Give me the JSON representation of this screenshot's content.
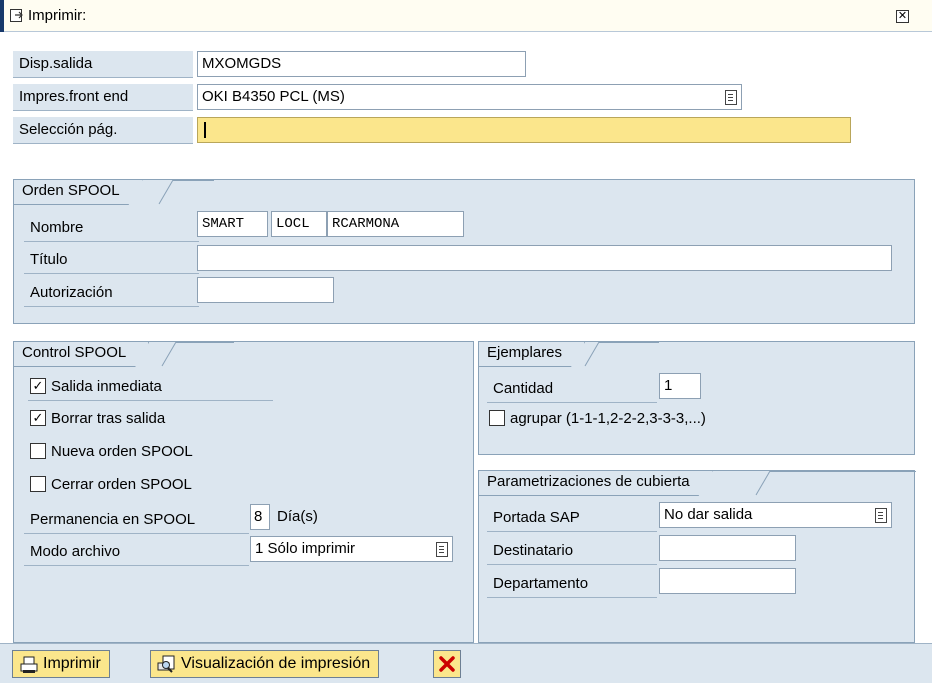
{
  "window": {
    "title": "Imprimir:"
  },
  "main_fields": {
    "disp_salida": {
      "label": "Disp.salida",
      "value": "MXOMGDS"
    },
    "impres_front_end": {
      "label": "Impres.front end",
      "value": "OKI B4350 PCL (MS)"
    },
    "seleccion_pag": {
      "label": "Selección pág.",
      "value": ""
    }
  },
  "orden_spool": {
    "title": "Orden SPOOL",
    "nombre": {
      "label": "Nombre",
      "part1": "SMART",
      "part2": "LOCL",
      "part3": "RCARMONA"
    },
    "titulo": {
      "label": "Título",
      "value": ""
    },
    "autorizacion": {
      "label": "Autorización",
      "value": ""
    }
  },
  "control_spool": {
    "title": "Control SPOOL",
    "salida_inmediata": {
      "label": "Salida inmediata",
      "checked": true
    },
    "borrar_tras_salida": {
      "label": "Borrar tras salida",
      "checked": true
    },
    "nueva_orden": {
      "label": "Nueva orden SPOOL",
      "checked": false
    },
    "cerrar_orden": {
      "label": "Cerrar orden SPOOL",
      "checked": false
    },
    "permanencia": {
      "label": "Permanencia en SPOOL",
      "value": "8",
      "unit": "Día(s)"
    },
    "modo_archivo": {
      "label": "Modo archivo",
      "value": "1 Sólo imprimir"
    }
  },
  "ejemplares": {
    "title": "Ejemplares",
    "cantidad": {
      "label": "Cantidad",
      "value": "1"
    },
    "agrupar": {
      "label": "agrupar (1-1-1,2-2-2,3-3-3,...)",
      "checked": false
    }
  },
  "cubierta": {
    "title": "Parametrizaciones de cubierta",
    "portada_sap": {
      "label": "Portada SAP",
      "value": "No dar salida"
    },
    "destinatario": {
      "label": "Destinatario",
      "value": ""
    },
    "departamento": {
      "label": "Departamento",
      "value": ""
    }
  },
  "footer": {
    "imprimir": "Imprimir",
    "visualizacion": "Visualización de impresión"
  },
  "colors": {
    "panel": "#dce6ef",
    "focus_field": "#fbe68c",
    "button": "#fbe68c",
    "cancel_icon": "#cc0000",
    "title_accent": "#17396b"
  }
}
